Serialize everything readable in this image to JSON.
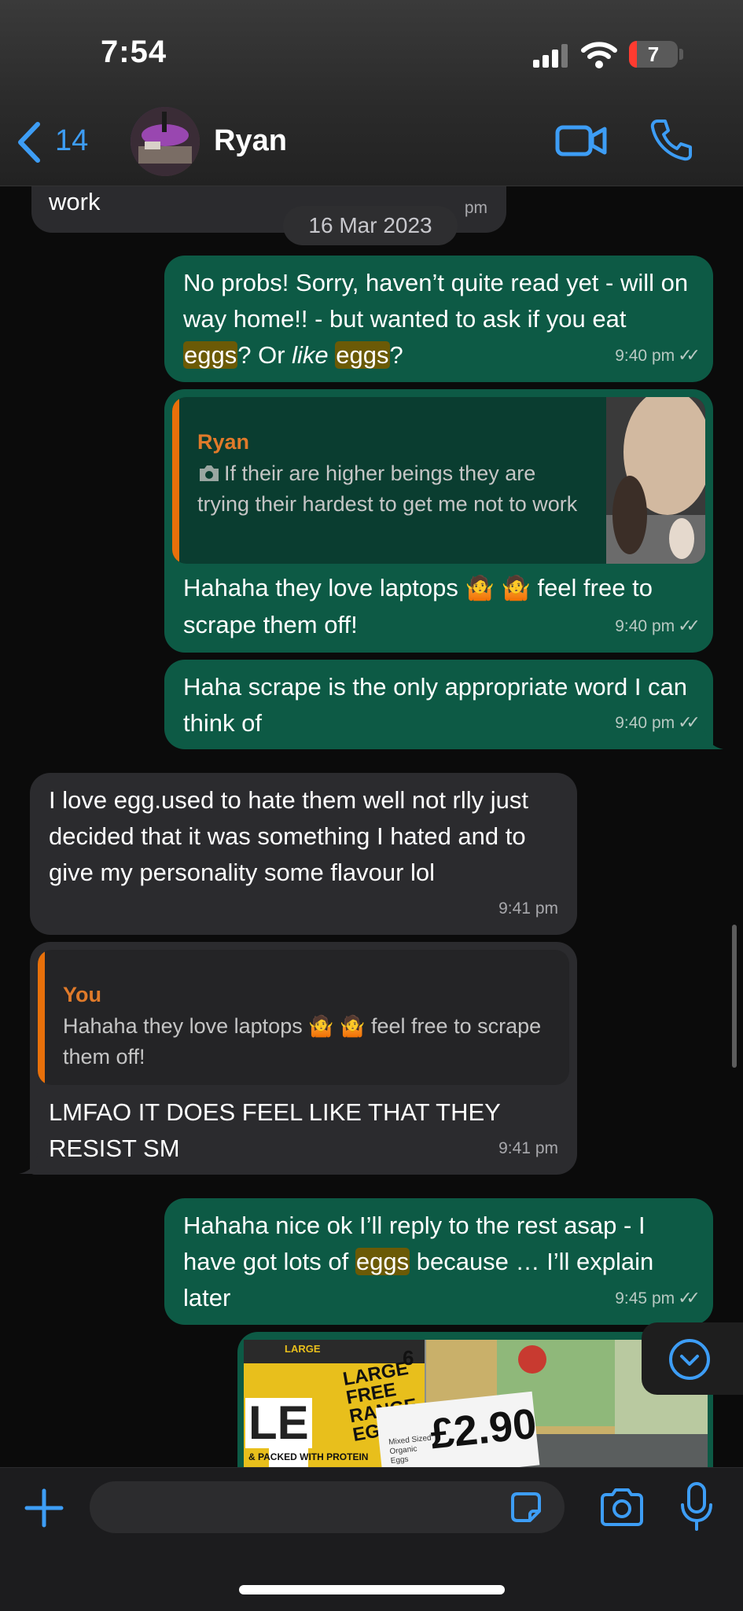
{
  "status_bar": {
    "time": "7:54",
    "battery": "7"
  },
  "header": {
    "back_count": "14",
    "contact_name": "Ryan"
  },
  "chat": {
    "prev_tail_text": "work",
    "prev_tail_time": "pm",
    "date_separator": "16 Mar 2023",
    "messages": [
      {
        "dir": "out",
        "parts": [
          "No probs! Sorry, haven’t quite read yet - will on way home!! - but wanted to ask if you eat ",
          "eggs",
          "? Or ",
          "like",
          " ",
          "eggs",
          "?"
        ],
        "time": "9:40 pm"
      },
      {
        "dir": "out",
        "quote_name": "Ryan",
        "quote_text": "If their are higher beings they are trying their hardest to get me not to work",
        "text_a": "Hahaha they love laptops",
        "text_b": "feel free to scrape them off!",
        "time": "9:40 pm"
      },
      {
        "dir": "out",
        "text": "Haha scrape is the only appropriate word I can think of",
        "time": "9:40 pm"
      },
      {
        "dir": "in",
        "text": "I love egg.used to hate them well not rlly just decided that it was something I hated and to give my personality some flavour lol",
        "time": "9:41 pm"
      },
      {
        "dir": "in",
        "quote_name": "You",
        "quote_text_a": "Hahaha they love laptops",
        "quote_text_b": "feel free to scrape them off!",
        "text": "LMFAO IT DOES FEEL LIKE THAT THEY RESIST SM",
        "time": "9:41 pm"
      },
      {
        "dir": "out",
        "parts": [
          "Hahaha nice ok I’ll reply to the rest asap - I have got lots of ",
          "eggs",
          " because … I’ll explain later"
        ],
        "time": "9:45 pm"
      }
    ],
    "photo": {
      "pack_count": "6",
      "pack_lines": [
        "LARGE",
        "FREE",
        "RANGE",
        "EGGS"
      ],
      "pack_small": "LARGE",
      "pack_side": "& PACKED WITH PROTEIN",
      "pack_letters": "LE",
      "price": "£2.90",
      "label_small": "Mixed Sized Organic Eggs"
    }
  },
  "icons": {
    "back": "chevron-left-icon",
    "video": "video-call-icon",
    "phone": "phone-icon",
    "camera_small": "camera-icon",
    "scroll_down": "chevron-down-circle-icon",
    "plus": "plus-icon",
    "sticker": "sticker-icon",
    "camera": "camera-icon",
    "mic": "microphone-icon"
  },
  "colors": {
    "accent": "#3d9df5",
    "outgoing_bubble": "#0d5a45",
    "incoming_bubble": "#2b2b2e",
    "highlight": "#6b5a06",
    "quote_bar": "#e8700a"
  }
}
